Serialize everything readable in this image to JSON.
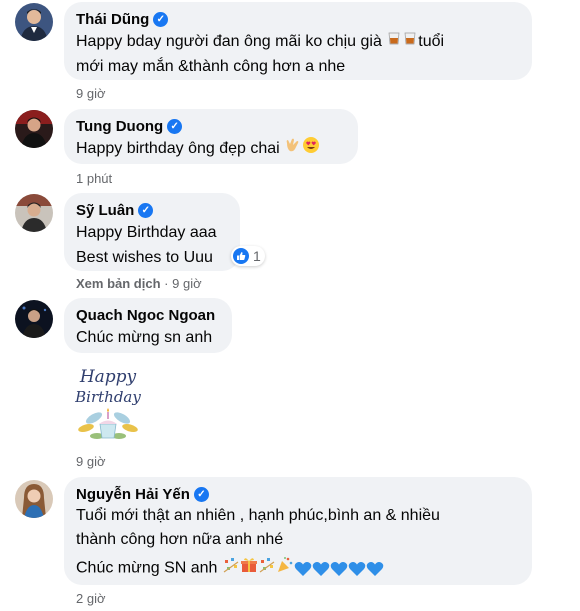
{
  "comments": [
    {
      "name": "Thái Dũng",
      "text_line1": "Happy bday người đan ông mãi ko chịu già",
      "text_line1_tail": "tuổi",
      "text_line2": "mới may mắn &thành công hơn a nhe",
      "time": "9 giờ",
      "emoji_icons": [
        "whisky-glass-icon",
        "whisky-glass-icon"
      ]
    },
    {
      "name": "Tung Duong",
      "text": "Happy birthday ông đẹp chai",
      "time": "1 phút",
      "emoji_icons": [
        "call-me-hand-icon",
        "heart-eyes-icon"
      ]
    },
    {
      "name": "Sỹ Luân",
      "text_line1": "Happy Birthday aaa",
      "text_line2": "Best wishes to Uuu",
      "reaction_count": "1",
      "translate": "Xem bản dịch",
      "separator": "·",
      "time": "9 giờ"
    },
    {
      "name": "Quach Ngoc Ngoan",
      "text": "Chúc mừng sn anh",
      "sticker_text": "Happy Birthday",
      "time": "9 giờ"
    },
    {
      "name": "Nguyễn Hải Yến",
      "text_line1": "Tuổi mới thật an nhiên , hạnh phúc,bình an & nhiều",
      "text_line2": "thành công hơn nữa anh nhé",
      "text_line3": "Chúc mừng SN anh",
      "time": "2 giờ",
      "emoji_icons": [
        "confetti-icon",
        "gift-icon",
        "confetti-icon",
        "party-popper-icon",
        "blue-heart-icon",
        "blue-heart-icon",
        "blue-heart-icon",
        "blue-heart-icon",
        "blue-heart-icon"
      ]
    }
  ],
  "colors": {
    "bubble": "#f0f2f5",
    "meta": "#65676b",
    "verified": "#1877f2",
    "blue_heart": "#1877f2"
  }
}
